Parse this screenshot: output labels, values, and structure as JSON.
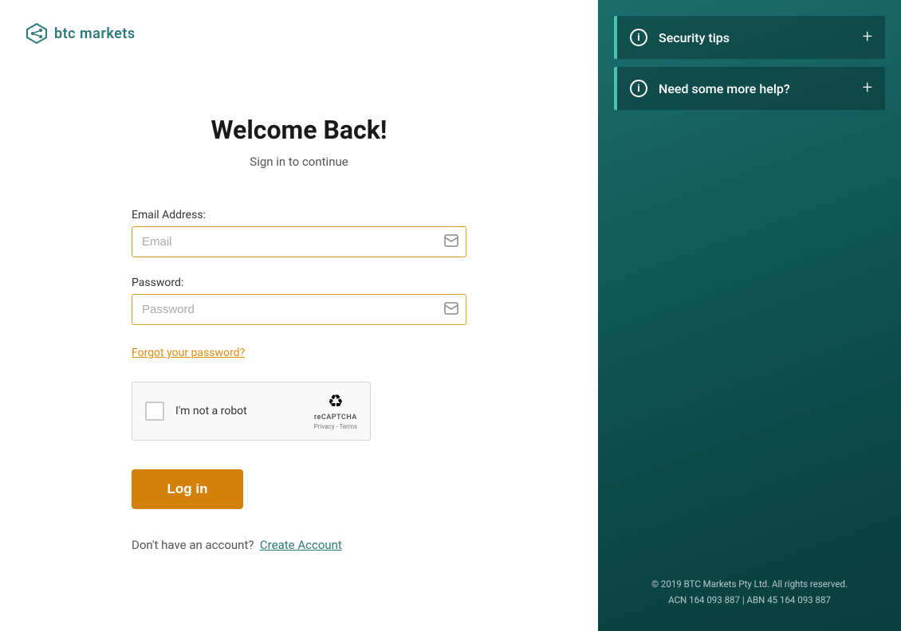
{
  "logo": {
    "text": "btc markets"
  },
  "left": {
    "title": "Welcome Back!",
    "subtitle": "Sign in to continue",
    "email_label": "Email Address:",
    "email_placeholder": "Email",
    "password_label": "Password:",
    "password_placeholder": "Password",
    "forgot_password": "Forgot your password?",
    "recaptcha_label": "I'm not a robot",
    "recaptcha_brand": "reCAPTCHA",
    "recaptcha_links": "Privacy - Terms",
    "login_button": "Log in",
    "no_account_text": "Don't have an account?",
    "create_account_link": "Create Account"
  },
  "right": {
    "security_tips_label": "Security tips",
    "help_label": "Need some more help?",
    "footer_line1": "© 2019 BTC Markets Pty Ltd. All rights reserved.",
    "footer_line2": "ACN 164 093 887 | ABN 45 164 093 887"
  },
  "colors": {
    "accent_orange": "#d4810a",
    "accent_teal": "#2d7a7a",
    "border_teal": "#4ac4b0"
  }
}
